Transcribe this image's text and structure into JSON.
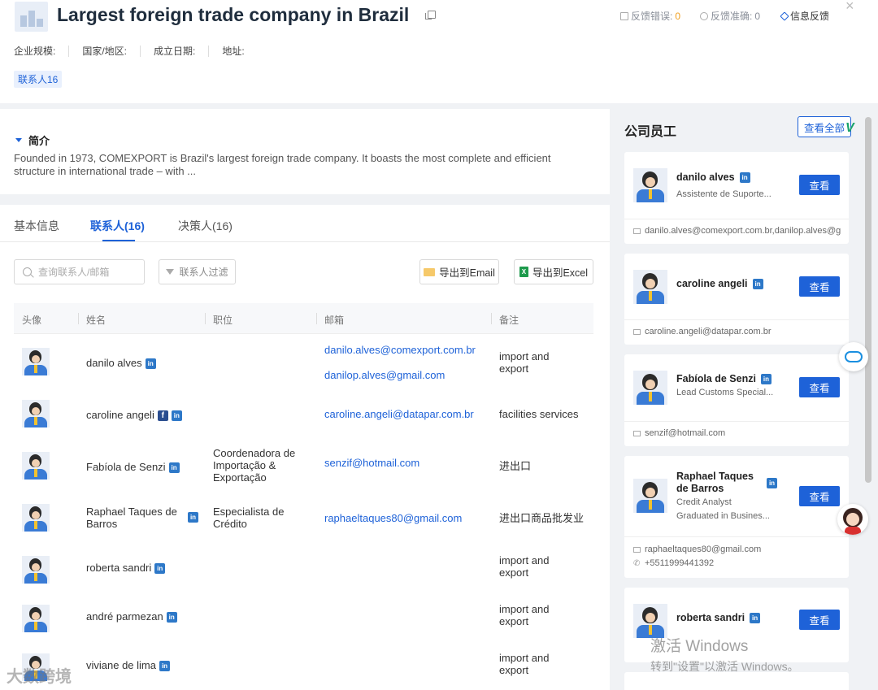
{
  "header": {
    "title": "Largest foreign trade company in Brazil",
    "feedback_error_label": "反馈错误:",
    "feedback_error_count": "0",
    "feedback_correct_label": "反馈准确:",
    "feedback_correct_count": "0",
    "info_feedback_label": "信息反馈",
    "meta": [
      "企业规模:",
      "国家/地区:",
      "成立日期:",
      "地址:"
    ],
    "contacts_tag": "联系人16"
  },
  "intro": {
    "title": "简介",
    "text": "Founded in 1973, COMEXPORT is Brazil's largest foreign trade company. It boasts the most complete and efficient structure in international trade – with ..."
  },
  "tabs": [
    "基本信息",
    "联系人(16)",
    "决策人(16)"
  ],
  "toolbar": {
    "search_placeholder": "查询联系人/邮箱",
    "filter_label": "联系人过滤",
    "export_email": "导出到Email",
    "export_excel": "导出到Excel",
    "excel_icon_letter": "X"
  },
  "table": {
    "headers": [
      "头像",
      "姓名",
      "职位",
      "邮箱",
      "备注"
    ],
    "rows": [
      {
        "name": "danilo alves",
        "position": "",
        "email": "danilo.alves@comexport.com.br",
        "email2": "danilop.alves@gmail.com",
        "note": "import and export"
      },
      {
        "name": "caroline angeli",
        "position": "",
        "email": "caroline.angeli@datapar.com.br",
        "email2": "",
        "note": "facilities services"
      },
      {
        "name": "Fabíola de Senzi",
        "position": "Coordenadora de Importação & Exportação",
        "email": "senzif@hotmail.com",
        "email2": "",
        "note": "进出口"
      },
      {
        "name": "Raphael Taques de Barros",
        "position": "Especialista de Crédito",
        "email": "raphaeltaques80@gmail.com",
        "email2": "",
        "note": "进出口商品批发业"
      },
      {
        "name": "roberta sandri",
        "position": "",
        "email": "",
        "email2": "",
        "note": "import and export"
      },
      {
        "name": "andré parmezan",
        "position": "",
        "email": "",
        "email2": "",
        "note": "import and export"
      },
      {
        "name": "viviane de lima",
        "position": "",
        "email": "",
        "email2": "",
        "note": "import and export"
      }
    ]
  },
  "social": {
    "linkedin": "in",
    "facebook": "f"
  },
  "sidebar": {
    "title": "公司员工",
    "view_all": "查看全部",
    "v_badge": "V",
    "view_button": "查看",
    "cards": [
      {
        "name": "danilo alves",
        "sub1": "Assistente de Suporte...",
        "sub2": "",
        "email": "danilo.alves@comexport.com.br,danilop.alves@g",
        "phone": ""
      },
      {
        "name": "caroline angeli",
        "sub1": "",
        "sub2": "",
        "email": "caroline.angeli@datapar.com.br",
        "phone": ""
      },
      {
        "name": "Fabíola de Senzi",
        "sub1": "Lead Customs Special...",
        "sub2": "",
        "email": "senzif@hotmail.com",
        "phone": ""
      },
      {
        "name": "Raphael Taques de Barros",
        "sub1": "Credit Analyst",
        "sub2": "Graduated in Busines...",
        "email": "raphaeltaques80@gmail.com",
        "phone": "+5511999441392"
      },
      {
        "name": "roberta sandri",
        "sub1": "",
        "sub2": "",
        "email": "",
        "phone": ""
      }
    ]
  },
  "watermark": {
    "line1": "激活 Windows",
    "line2": "转到\"设置\"以激活 Windows。",
    "brand": "大数跨境"
  },
  "colors": {
    "accent": "#1e62d8",
    "linkedin": "#2d78c8",
    "facebook": "#2a4d8f",
    "warning": "#f0a020"
  }
}
